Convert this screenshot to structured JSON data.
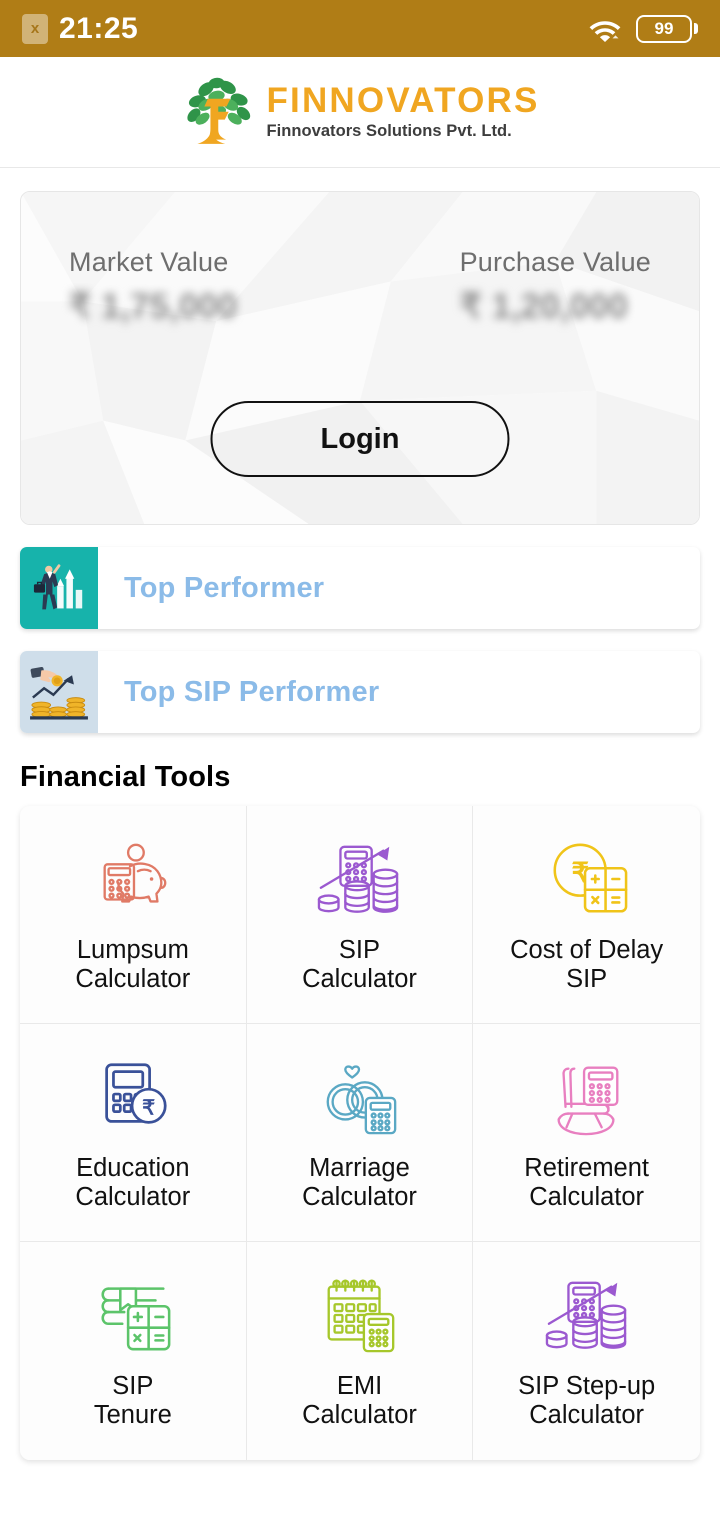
{
  "status_bar": {
    "sim_icon": "sim-x-icon",
    "sim_glyph": "x",
    "time": "21:25",
    "wifi_icon": "wifi-icon",
    "battery_icon": "battery-icon",
    "battery_level": "99"
  },
  "header": {
    "logo_icon": "tree-logo-icon",
    "brand_name": "FINNOVATORS",
    "brand_tagline": "Finnovators Solutions Pvt. Ltd.",
    "brand_color": "#f0a621",
    "tagline_color": "#3d3d3d"
  },
  "portfolio_card": {
    "market": {
      "label": "Market Value",
      "amount": "₹ 1,75,000"
    },
    "purchase": {
      "label": "Purchase Value",
      "amount": "₹ 1,20,000"
    },
    "login_label": "Login"
  },
  "banners": [
    {
      "label": "Top Performer",
      "icon": "businessman-growth-chart-icon",
      "icon_bg": "#17b3ab",
      "text_color": "#8bbbe8"
    },
    {
      "label": "Top SIP Performer",
      "icon": "hand-coin-stacks-growth-icon",
      "icon_bg": "#cfdeea",
      "text_color": "#8bbbe8"
    }
  ],
  "financial_tools": {
    "title": "Financial Tools",
    "items": [
      {
        "label": "Lumpsum\nCalculator",
        "icon": "piggy-bank-calculator-icon",
        "color": "#e07a66"
      },
      {
        "label": "SIP\nCalculator",
        "icon": "calculator-coins-arrow-icon",
        "color": "#9b59d0"
      },
      {
        "label": "Cost of Delay\nSIP",
        "icon": "rupee-coin-calculator-icon",
        "color": "#f0c419"
      },
      {
        "label": "Education\nCalculator",
        "icon": "calculator-rupee-coin-icon",
        "color": "#3a5199"
      },
      {
        "label": "Marriage\nCalculator",
        "icon": "wedding-rings-calculator-icon",
        "color": "#5aa8c4"
      },
      {
        "label": "Retirement\nCalculator",
        "icon": "rocking-chair-calculator-icon",
        "color": "#e87fc0"
      },
      {
        "label": "SIP\nTenure",
        "icon": "book-bookmark-calculator-icon",
        "color": "#5cc46a"
      },
      {
        "label": "EMI\nCalculator",
        "icon": "calendar-calculator-icon",
        "color": "#a6c72b"
      },
      {
        "label": "SIP Step-up\nCalculator",
        "icon": "calculator-coins-arrow-icon",
        "color": "#9b59d0"
      }
    ]
  }
}
